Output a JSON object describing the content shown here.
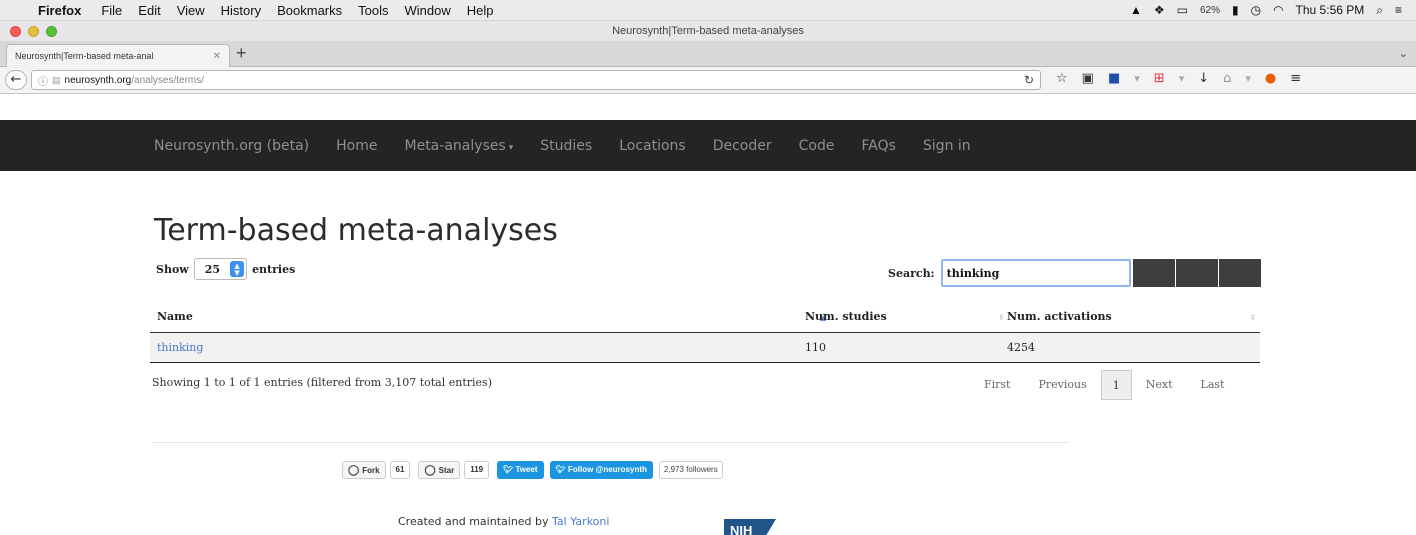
{
  "os_menubar": {
    "app": "Firefox",
    "items": [
      "File",
      "Edit",
      "View",
      "History",
      "Bookmarks",
      "Tools",
      "Window",
      "Help"
    ],
    "battery": "62%",
    "clock": "Thu 5:56 PM"
  },
  "window": {
    "title": "Neurosynth|Term-based meta-analyses"
  },
  "tabs": [
    {
      "label": "Neurosynth|Term-based meta-anal"
    }
  ],
  "urlbar": {
    "host": "neurosynth.org",
    "path": "/analyses/terms/"
  },
  "site_nav": {
    "brand": "Neurosynth.org (beta)",
    "links": [
      "Home",
      "Meta-analyses",
      "Studies",
      "Locations",
      "Decoder",
      "Code",
      "FAQs",
      "Sign in"
    ]
  },
  "page": {
    "title": "Term-based meta-analyses",
    "show_label": "Show",
    "entries_label": "entries",
    "page_length": "25",
    "search_label": "Search:",
    "search_value": "thinking"
  },
  "table": {
    "columns": [
      "Name",
      "Num. studies",
      "Num. activations"
    ],
    "rows": [
      {
        "name": "thinking",
        "studies": "110",
        "activations": "4254"
      }
    ]
  },
  "table_info": "Showing 1 to 1 of 1 entries (filtered from 3,107 total entries)",
  "pagination": {
    "first": "First",
    "previous": "Previous",
    "current": "1",
    "next": "Next",
    "last": "Last"
  },
  "social": {
    "fork_label": "Fork",
    "fork_count": "61",
    "star_label": "Star",
    "star_count": "119",
    "tweet_label": "Tweet",
    "follow_label": "Follow @neurosynth",
    "followers": "2,973 followers"
  },
  "footer": {
    "credit_prefix": "Created and maintained by",
    "author": "Tal Yarkoni",
    "logo_text": "NIH"
  }
}
